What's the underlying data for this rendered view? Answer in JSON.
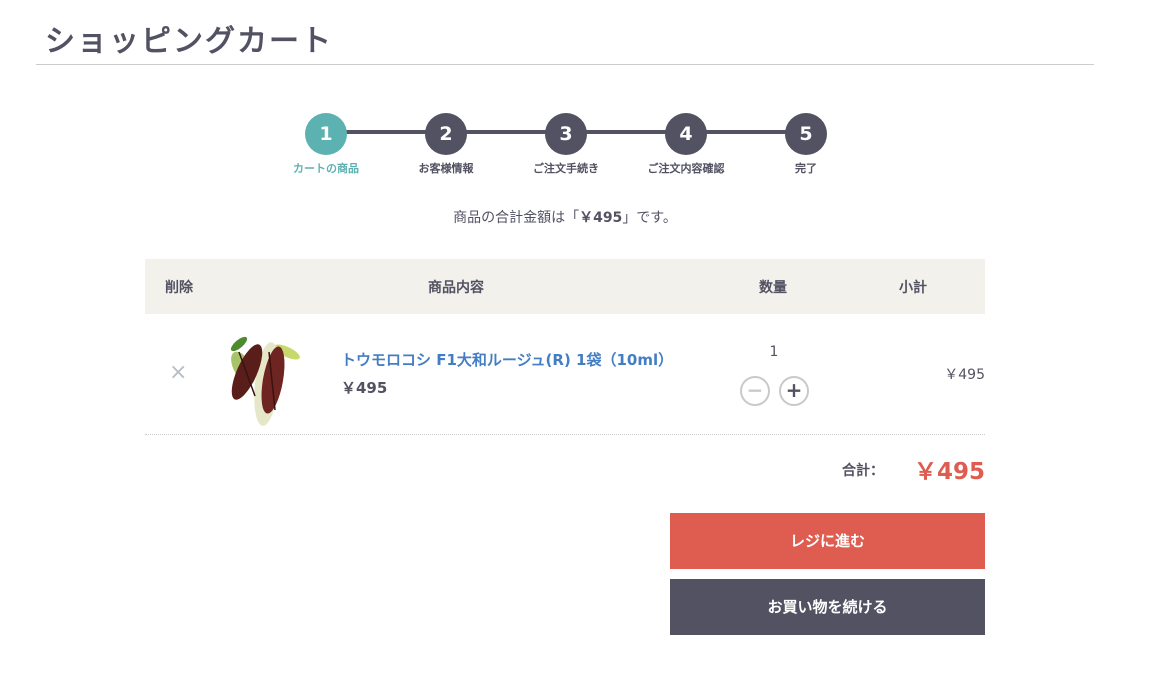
{
  "page": {
    "title": "ショッピングカート"
  },
  "steps": [
    {
      "number": "1",
      "label": "カートの商品"
    },
    {
      "number": "2",
      "label": "お客様情報"
    },
    {
      "number": "3",
      "label": "ご注文手続き"
    },
    {
      "number": "4",
      "label": "ご注文内容確認"
    },
    {
      "number": "5",
      "label": "完了"
    }
  ],
  "summary": {
    "prefix": "商品の合計金額は「",
    "amount": "￥495",
    "suffix": "」です。"
  },
  "table": {
    "headers": {
      "delete": "削除",
      "item": "商品内容",
      "quantity": "数量",
      "subtotal": "小計"
    },
    "rows": [
      {
        "remove_icon": "×",
        "name": "トウモロコシ F1大和ルージュ(R) 1袋（10ml）",
        "price": "￥495",
        "quantity": "1",
        "minus_label": "−",
        "plus_label": "+",
        "subtotal": "￥495",
        "image_icon": "corn-image"
      }
    ]
  },
  "total": {
    "label": "合計：",
    "value": "￥495"
  },
  "buttons": {
    "checkout": "レジに進む",
    "continue": "お買い物を続ける"
  },
  "colors": {
    "accent": "#5cb1b1",
    "primary_dark": "#525263",
    "checkout": "#de5d50",
    "link": "#437ec4"
  }
}
